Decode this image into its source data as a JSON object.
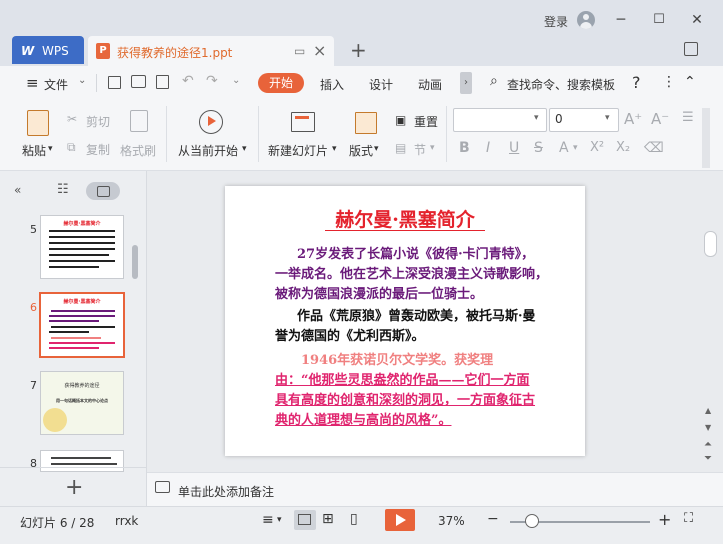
{
  "window": {
    "login_label": "登录",
    "minimize": "─",
    "maximize": "☐",
    "close": "✕"
  },
  "tabs": {
    "home": {
      "logo": "W",
      "label": "WPS"
    },
    "document": {
      "title": "获得教养的途径1.ppt",
      "icon_letter": "P"
    },
    "new_tab": "+"
  },
  "menu": {
    "file": "文件",
    "items": [
      "开始",
      "插入",
      "设计",
      "动画"
    ],
    "search": "查找命令、搜索模板",
    "help": "?",
    "more": "⋮",
    "collapse": "⌃",
    "scroll_arrow": "›"
  },
  "ribbon": {
    "paste": "粘贴",
    "cut": "剪切",
    "copy": "复制",
    "format_painter": "格式刷",
    "play_from_current": "从当前开始",
    "new_slide": "新建幻灯片",
    "layout": "版式",
    "reset": "重置",
    "section": "节",
    "font_name": "",
    "font_size": "0",
    "bold": "B",
    "italic": "I",
    "underline": "U",
    "strikethrough": "S",
    "font_color": "A",
    "superscript": "X²",
    "subscript": "X₂"
  },
  "slides_panel": {
    "thumbnails": [
      {
        "number": "5",
        "title": "赫尔曼·黑塞简介"
      },
      {
        "number": "6",
        "title": "赫尔曼·黑塞简介",
        "selected": true
      },
      {
        "number": "7",
        "title": "获得教养的途径",
        "subtitle": "用一句话概括本文的中心论点"
      },
      {
        "number": "8",
        "title": ""
      }
    ],
    "add_slide": "+"
  },
  "slide": {
    "title": "赫尔曼·黑塞简介",
    "p1_lines": [
      "27岁发表了长篇小说《彼得·卡门青特》，",
      "一举成名。他在艺术上深受浪漫主义诗歌影响，",
      "被称为德国浪漫派的最后一位骑士。"
    ],
    "p2_lines": [
      "作品《荒原狼》曾轰动欧美，被托马斯·曼",
      "誉为德国的《尤利西斯》。"
    ],
    "p3_line": "1946年获诺贝尔文学奖。获奖理",
    "p4_lines": [
      "由：“他那些灵思盎然的作品——它们一方面",
      "具有高度的创意和深刻的洞见，一方面象征古",
      "典的人道理想与高尚的风格”。"
    ]
  },
  "notes": {
    "placeholder": "单击此处添加备注"
  },
  "status": {
    "slide_info": "幻灯片 6 / 28",
    "theme": "rrxk",
    "zoom": "37%",
    "zoom_minus": "−",
    "zoom_plus": "+"
  },
  "colors": {
    "accent_orange": "#e8633a",
    "slide_title_red": "#e4232d",
    "purple_text": "#6a1a7a",
    "pink_text": "#e0246e",
    "salmon_text": "#f08080",
    "wps_blue": "#3d6cc6"
  }
}
